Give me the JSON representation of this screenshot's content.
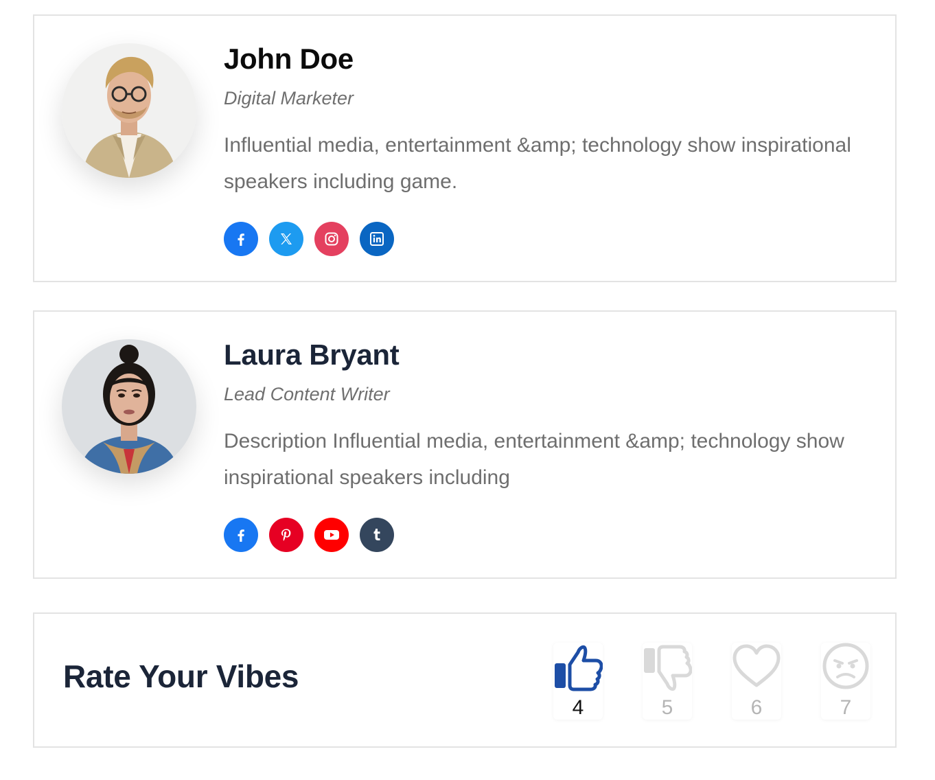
{
  "profiles": [
    {
      "name": "John Doe",
      "role": "Digital Marketer",
      "description": "Influential media, entertainment &amp; technology show inspirational speakers including game.",
      "socials": [
        {
          "icon": "facebook-icon",
          "color": "#1877f2"
        },
        {
          "icon": "x-twitter-icon",
          "color": "#1d9bf0"
        },
        {
          "icon": "instagram-icon",
          "color": "#e4405f"
        },
        {
          "icon": "linkedin-icon",
          "color": "#0a66c2"
        }
      ]
    },
    {
      "name": "Laura Bryant",
      "role": "Lead Content Writer",
      "description": "Description Influential media, entertainment &amp; technology show inspirational speakers including",
      "socials": [
        {
          "icon": "facebook-icon",
          "color": "#1877f2"
        },
        {
          "icon": "pinterest-icon",
          "color": "#e60023"
        },
        {
          "icon": "youtube-icon",
          "color": "#ff0000"
        },
        {
          "icon": "tumblr-icon",
          "color": "#34465d"
        }
      ]
    }
  ],
  "vibes": {
    "title": "Rate Your Vibes",
    "reactions": [
      {
        "icon": "thumbs-up-icon",
        "count": "4",
        "active": true,
        "color": "#1d4ea6"
      },
      {
        "icon": "thumbs-down-icon",
        "count": "5",
        "active": false,
        "color": "#d9d9d9"
      },
      {
        "icon": "heart-icon",
        "count": "6",
        "active": false,
        "color": "#d9d9d9"
      },
      {
        "icon": "angry-face-icon",
        "count": "7",
        "active": false,
        "color": "#d9d9d9"
      }
    ]
  }
}
